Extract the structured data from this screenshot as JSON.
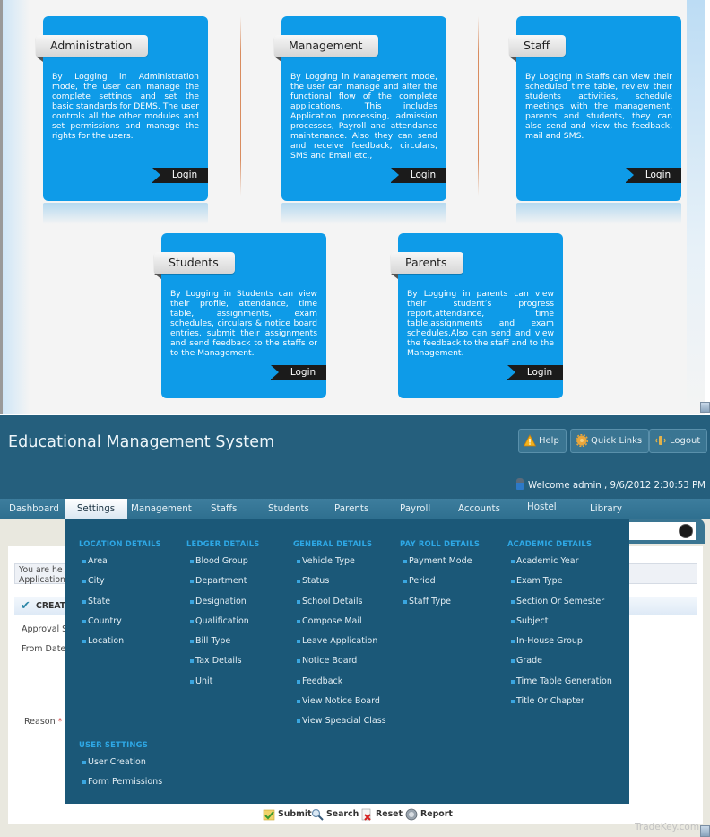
{
  "modules": [
    {
      "title": "Administration",
      "description": "By Logging in Administration mode, the user can manage the complete settings and set the basic standards for DEMS. The user controls all the other modules and set permissions and manage the rights for the users.",
      "login_label": "Login"
    },
    {
      "title": "Management",
      "description": "By Logging in Management mode, the user can manage and alter the functional flow of the complete applications. This includes Application processing, admission processes, Payroll and attendance maintenance. Also they can send and receive feedback, circulars, SMS and Email etc.,",
      "login_label": "Login"
    },
    {
      "title": "Staff",
      "description": "By Logging in Staffs can view their scheduled time table, review their students activities, schedule meetings with the management, parents and students, they can also send and view the feedback, mail and SMS.",
      "login_label": "Login"
    },
    {
      "title": "Students",
      "description": "By Logging in Students can view their profile, attendance, time table, assignments, exam schedules, circulars & notice board entries, submit their assignments and send feedback to the staffs or to the Management.",
      "login_label": "Login"
    },
    {
      "title": "Parents",
      "description": "By Logging in parents can view their student’s progress report,attendance, time table,assignments and exam schedules.Also can send and view the feedback to the staff and to the Management.",
      "login_label": "Login"
    }
  ],
  "header": {
    "title": "Educational Management System",
    "buttons": [
      {
        "label": "Help",
        "icon": "warning-icon"
      },
      {
        "label": "Quick Links",
        "icon": "gear-icon"
      },
      {
        "label": "Logout",
        "icon": "logout-icon"
      }
    ],
    "welcome": "Welcome admin , 9/6/2012 2:30:53 PM"
  },
  "nav": {
    "items": [
      "Dashboard",
      "Settings",
      "Management",
      "Staffs",
      "Students",
      "Parents",
      "Payroll",
      "Accounts",
      "Hostel",
      "Library"
    ],
    "active": "Settings"
  },
  "page": {
    "breadcrumb_line1": "You are he",
    "breadcrumb_line2": "Application",
    "create_label": "CREATE",
    "labels": {
      "approval": "Approval S",
      "from_date": "From Date",
      "reason": "Reason",
      "required_mark": "*"
    }
  },
  "menu": {
    "sections": [
      {
        "heading": "LOCATION DETAILS",
        "items": [
          "Area",
          "City",
          "State",
          "Country",
          "Location"
        ]
      },
      {
        "heading": "LEDGER DETAILS",
        "items": [
          "Blood Group",
          "Department",
          "Designation",
          "Qualification",
          "Bill Type",
          "Tax Details",
          "Unit"
        ]
      },
      {
        "heading": "GENERAL DETAILS",
        "items": [
          "Vehicle Type",
          "Status",
          "School Details",
          "Compose Mail",
          "Leave Application",
          "Notice Board",
          "Feedback",
          "View Notice Board",
          "View Speacial Class"
        ]
      },
      {
        "heading": "PAY ROLL DETAILS",
        "items": [
          "Payment Mode",
          "Period",
          "Staff Type"
        ]
      },
      {
        "heading": "ACADEMIC DETAILS",
        "items": [
          "Academic Year",
          "Exam Type",
          "Section Or Semester",
          "Subject",
          "In-House Group",
          "Grade",
          "Time Table Generation",
          "Title Or Chapter"
        ]
      },
      {
        "heading": "USER SETTINGS",
        "items": [
          "User Creation",
          "Form Permissions"
        ]
      }
    ]
  },
  "actions": [
    {
      "label": "Submit",
      "icon": "submit-icon"
    },
    {
      "label": "Search",
      "icon": "search-icon"
    },
    {
      "label": "Reset",
      "icon": "reset-icon"
    },
    {
      "label": "Report",
      "icon": "report-icon"
    }
  ],
  "watermark": "TradeKey.com",
  "colors": {
    "card_blue": "#0e9be8",
    "header_teal": "#255f7d",
    "menu_bg": "#1b5878",
    "menu_heading": "#2ea8e6"
  }
}
